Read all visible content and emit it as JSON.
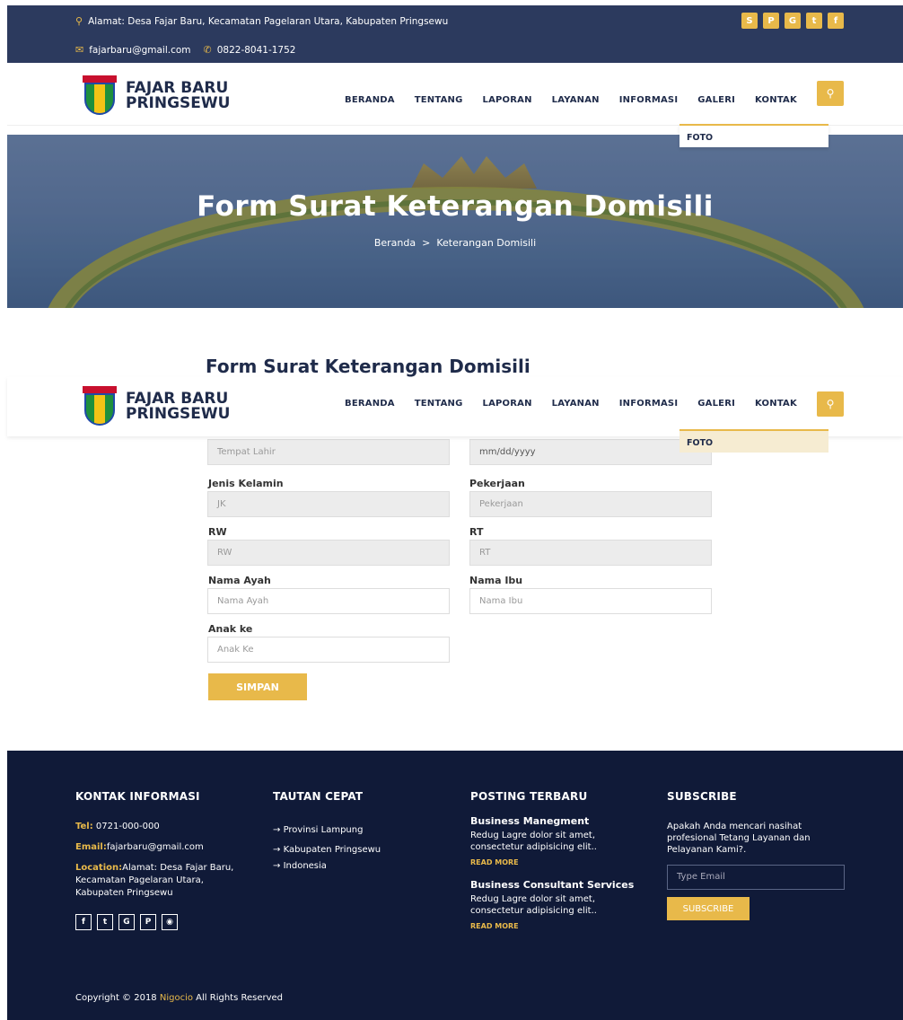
{
  "topbar": {
    "address": "Alamat: Desa Fajar Baru, Kecamatan Pagelaran Utara, Kabupaten Pringsewu",
    "email": "fajarbaru@gmail.com",
    "phone": "0822-8041-1752",
    "social": [
      "skype-icon",
      "pinterest-icon",
      "google-icon",
      "twitter-icon",
      "facebook-icon"
    ]
  },
  "header": {
    "logo_line1": "FAJAR BARU",
    "logo_line2": "PRINGSEWU",
    "nav": [
      "BERANDA",
      "TENTANG",
      "LAPORAN",
      "LAYANAN",
      "INFORMASI",
      "GALERI",
      "KONTAK"
    ],
    "dropdown_item": "FOTO"
  },
  "hero": {
    "title": "Form Surat Keterangan Domisili",
    "breadcrumb_home": "Beranda",
    "breadcrumb_sep": ">",
    "breadcrumb_current": "Keterangan Domisili"
  },
  "form": {
    "title": "Form Surat Keterangan Domisili",
    "fields": {
      "tempat_lahir_placeholder": "Tempat Lahir",
      "tanggal_placeholder": "mm/dd/yyyy",
      "jk_label": "Jenis Kelamin",
      "jk_placeholder": "JK",
      "pekerjaan_label": "Pekerjaan",
      "pekerjaan_placeholder": "Pekerjaan",
      "rw_label": "RW",
      "rw_placeholder": "RW",
      "rt_label": "RT",
      "rt_placeholder": "RT",
      "ayah_label": "Nama Ayah",
      "ayah_placeholder": "Nama Ayah",
      "ibu_label": "Nama Ibu",
      "ibu_placeholder": "Nama Ibu",
      "anak_label": "Anak ke",
      "anak_placeholder": "Anak Ke"
    },
    "submit": "SIMPAN"
  },
  "footer": {
    "kontak": {
      "title": "KONTAK INFORMASI",
      "tel_label": "Tel:",
      "tel": " 0721-000-000",
      "email_label": "Email:",
      "email": "fajarbaru@gmail.com",
      "location_label": "Location:",
      "location": "Alamat: Desa Fajar Baru, Kecamatan Pagelaran Utara, Kabupaten Pringsewu"
    },
    "tautan": {
      "title": "TAUTAN CEPAT",
      "links": [
        "Provinsi Lampung",
        "Kabupaten Pringsewu",
        "Indonesia"
      ]
    },
    "posting": {
      "title": "POSTING TERBARU",
      "posts": [
        {
          "title": "Business Manegment",
          "text": "Redug Lagre dolor sit amet, consectetur adipisicing elit..",
          "more": "READ MORE"
        },
        {
          "title": "Business Consultant Services",
          "text": "Redug Lagre dolor sit amet, consectetur adipisicing elit..",
          "more": "READ MORE"
        }
      ]
    },
    "subscribe": {
      "title": "SUBSCRIBE",
      "text": "Apakah Anda mencari nasihat profesional Tetang Layanan dan Pelayanan Kami?.",
      "placeholder": "Type Email",
      "button": "SUBSCRIBE"
    },
    "copyright_pre": "Copyright © 2018 ",
    "copyright_brand": "Nigocio",
    "copyright_post": " All Rights Reserved"
  },
  "colors": {
    "accent": "#e8b94a",
    "navy": "#101a38",
    "topbar": "#2c3a5e"
  }
}
